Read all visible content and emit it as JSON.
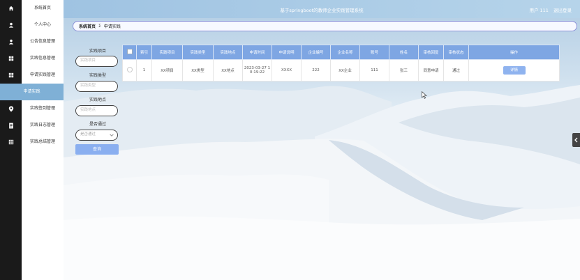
{
  "header": {
    "title": "基于springboot的教师企业实践管理系统",
    "user": "用户 111",
    "logout": "退出登录"
  },
  "nav": {
    "items": [
      {
        "label": "系统首页",
        "icon": "home-icon"
      },
      {
        "label": "个人中心",
        "icon": "user-icon"
      },
      {
        "label": "公告信息管理",
        "icon": "user-icon"
      },
      {
        "label": "实践信息管理",
        "icon": "grid-icon"
      },
      {
        "label": "申请实践管理",
        "icon": "grid-icon"
      },
      {
        "label": "申请实践",
        "icon": "",
        "active": true
      },
      {
        "label": "实践签到管理",
        "icon": "location-pin-icon"
      },
      {
        "label": "实践日志管理",
        "icon": "document-icon"
      },
      {
        "label": "实践总结管理",
        "icon": "table-icon"
      }
    ]
  },
  "breadcrumb": {
    "home": "系统首页",
    "separator": "Σ",
    "current": "申请实践"
  },
  "filters": {
    "project_label": "实践项目",
    "project_placeholder": "实践项目",
    "type_label": "实践类型",
    "type_placeholder": "实践类型",
    "place_label": "实践地点",
    "place_placeholder": "实践地点",
    "passed_label": "是否通过",
    "passed_placeholder": "是否通过",
    "search_button": "查询"
  },
  "table": {
    "columns": [
      "索引",
      "实践项目",
      "实践类型",
      "实践地点",
      "申请时间",
      "申请说明",
      "企业编号",
      "企业名称",
      "账号",
      "姓名",
      "审核回复",
      "审核状态",
      "操作"
    ],
    "rows": [
      [
        "1",
        "XX项目",
        "XX类型",
        "XX地点",
        "2023-03-27 10:19:22",
        "XXXX",
        "222",
        "XX企业",
        "111",
        "张三",
        "同意申请",
        "通过"
      ]
    ],
    "detail_button": "详情"
  },
  "colors": {
    "accent": "#7ea6e3",
    "active": "#7fb0d6",
    "iconbar": "#1a1a1a"
  }
}
